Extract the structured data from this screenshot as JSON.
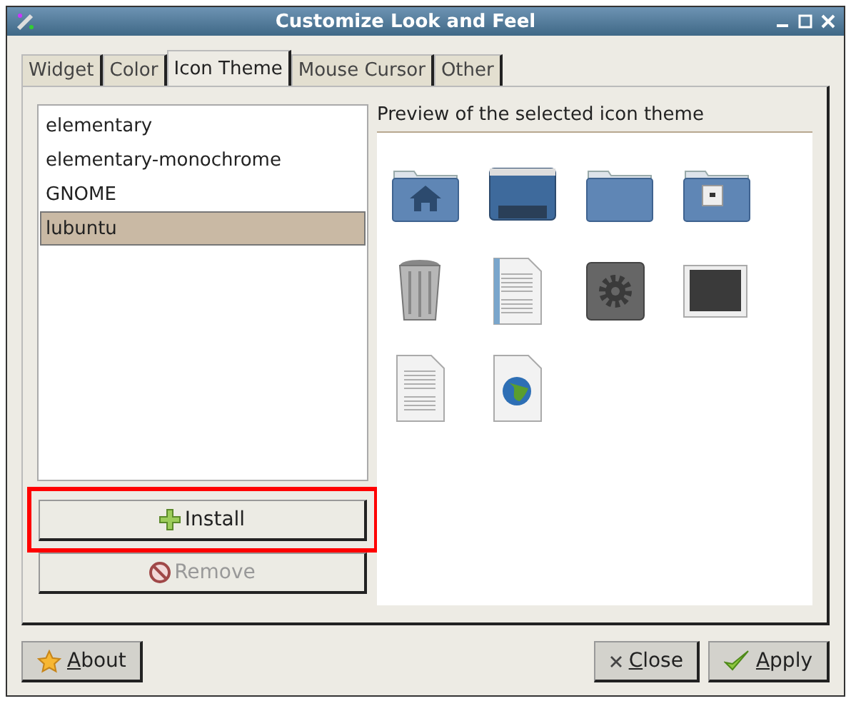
{
  "window": {
    "title": "Customize Look and Feel"
  },
  "tabs": [
    {
      "label": "Widget",
      "selected": false
    },
    {
      "label": "Color",
      "selected": false
    },
    {
      "label": "Icon Theme",
      "selected": true
    },
    {
      "label": "Mouse Cursor",
      "selected": false
    },
    {
      "label": "Other",
      "selected": false
    }
  ],
  "themes": [
    {
      "name": "elementary",
      "selected": false
    },
    {
      "name": "elementary-monochrome",
      "selected": false
    },
    {
      "name": "GNOME",
      "selected": false
    },
    {
      "name": "lubuntu",
      "selected": true
    }
  ],
  "theme_buttons": [
    {
      "label": "Install",
      "kind": "install",
      "disabled": false,
      "highlighted": true
    },
    {
      "label": "Remove",
      "kind": "remove",
      "disabled": true,
      "highlighted": false
    }
  ],
  "preview": {
    "title": "Preview of the selected icon theme"
  },
  "footer": {
    "left": [
      {
        "label": "About",
        "kind": "about",
        "underline_first": true
      }
    ],
    "right": [
      {
        "label": "Close",
        "kind": "close",
        "underline_first": true
      },
      {
        "label": "Apply",
        "kind": "apply",
        "underline_first": true
      }
    ]
  }
}
